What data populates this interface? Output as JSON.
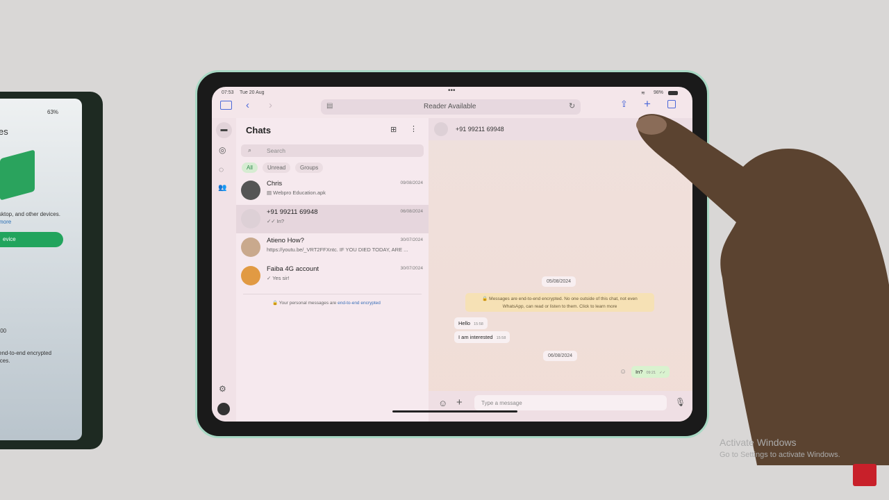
{
  "phone": {
    "status": "63%",
    "text1": "es",
    "text2": "sktop, and other devices.",
    "link": "more",
    "button": "evice",
    "time": ":00",
    "footer1": "end-to-end encrypted",
    "footer2": "ices."
  },
  "ipad": {
    "status": {
      "time": "07:53",
      "date": "Tue 20 Aug",
      "battery": "98%"
    },
    "toolbar": {
      "url_label": "Reader Available",
      "icons": [
        "sidebar-icon",
        "back-icon",
        "forward-icon",
        "reader-icon",
        "reload-icon",
        "share-icon",
        "new-tab-icon",
        "tabs-icon"
      ]
    },
    "rail": {
      "icons": [
        "chats-icon",
        "status-icon",
        "channels-icon",
        "communities-icon",
        "settings-icon",
        "profile-icon"
      ]
    },
    "list": {
      "title": "Chats",
      "search_placeholder": "Search",
      "filters": [
        "All",
        "Unread",
        "Groups"
      ],
      "chats": [
        {
          "name": "Chris",
          "preview": "Webpro Education.apk",
          "date": "09/08/2024"
        },
        {
          "name": "+91 99211 69948",
          "preview": "In?",
          "date": "06/08/2024"
        },
        {
          "name": "Atieno How?",
          "preview": "https://youtu.be/_VRT2FFXntc. IF YOU DIED TODAY, ARE ...",
          "date": "30/07/2024"
        },
        {
          "name": "Faiba 4G account",
          "preview": "Yes sir!",
          "date": "30/07/2024"
        }
      ],
      "footer_prefix": "Your personal messages are ",
      "footer_link": "end-to-end encrypted"
    },
    "chat": {
      "contact": "+91 99211 69948",
      "date1": "05/08/2024",
      "encryption_notice": "Messages are end-to-end encrypted. No one outside of this chat, not even WhatsApp, can read or listen to them. Click to learn more",
      "messages": [
        {
          "text": "Hello",
          "time": "15:58"
        },
        {
          "text": "I am interested",
          "time": "15:58"
        },
        {
          "text": "In?",
          "time": "09:21"
        }
      ],
      "date2": "06/08/2024",
      "composer_placeholder": "Type a message"
    }
  },
  "watermark": {
    "title": "Activate Windows",
    "subtitle": "Go to Settings to activate Windows."
  },
  "colors": {
    "accent": "#25a366",
    "active_chip": "#d6ecd2",
    "outgoing": "#d9f2cf",
    "notice": "#f6e1b5"
  }
}
